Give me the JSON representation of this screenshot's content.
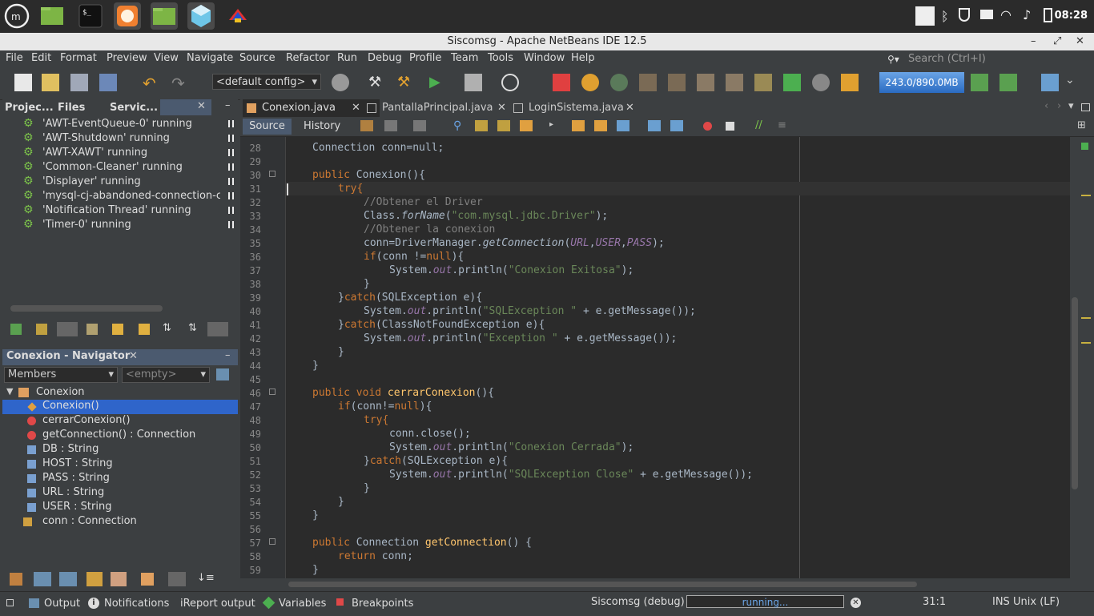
{
  "taskbar": {
    "apps": [
      "mint-menu-icon",
      "files-icon",
      "terminal-icon",
      "firefox-icon",
      "folder-icon",
      "netbeans-icon",
      "colorful-app-icon"
    ],
    "clock": "08:28"
  },
  "window": {
    "title": "Siscomsg - Apache NetBeans IDE 12.5"
  },
  "menubar": {
    "items": [
      "File",
      "Edit",
      "Format",
      "Preview",
      "View",
      "Navigate",
      "Source",
      "Refactor",
      "Run",
      "Debug",
      "Profile",
      "Team",
      "Tools",
      "Window",
      "Help"
    ],
    "search_placeholder": "Search (Ctrl+I)"
  },
  "toolbar": {
    "config": "<default config>",
    "memory": "243.0/890.0MB"
  },
  "left_tabs": [
    "Projec...",
    "Files",
    "Servic..."
  ],
  "threads": [
    "'AWT-EventQueue-0' running",
    "'AWT-Shutdown' running",
    "'AWT-XAWT' running",
    "'Common-Cleaner' running",
    "'Displayer' running",
    "'mysql-cj-abandoned-connection-cle",
    "'Notification Thread' running",
    "'Timer-0' running"
  ],
  "navigator": {
    "title": "Conexion - Navigator",
    "filter": "Members",
    "empty": "<empty>",
    "class_name": "Conexion",
    "members": [
      {
        "name": "Conexion()",
        "type": ""
      },
      {
        "name": "cerrarConexion()",
        "type": ""
      },
      {
        "name": "getConnection() : ",
        "type": "Connection"
      },
      {
        "name": "DB : ",
        "type": "String"
      },
      {
        "name": "HOST : ",
        "type": "String"
      },
      {
        "name": "PASS : ",
        "type": "String"
      },
      {
        "name": "URL : ",
        "type": "String"
      },
      {
        "name": "USER : ",
        "type": "String"
      },
      {
        "name": "conn : ",
        "type": "Connection"
      }
    ]
  },
  "editor_tabs": [
    "Conexion.java",
    "PantallaPrincipal.java",
    "LoginSistema.java"
  ],
  "source_tabs": {
    "source": "Source",
    "history": "History"
  },
  "line_numbers": [
    "28",
    "29",
    "30",
    "31",
    "32",
    "33",
    "34",
    "35",
    "36",
    "37",
    "38",
    "39",
    "40",
    "41",
    "42",
    "43",
    "44",
    "45",
    "46",
    "47",
    "48",
    "49",
    "50",
    "51",
    "52",
    "53",
    "54",
    "55",
    "56",
    "57",
    "58",
    "59"
  ],
  "code": {
    "l28": "Connection conn=null;",
    "l30a": "public ",
    "l30b": "Conexion(){",
    "l31": "try{",
    "l32": "//Obtener el Driver",
    "l33a": "Class.",
    "l33b": "forName",
    "l33c": "(",
    "l33d": "\"com.mysql.jdbc.Driver\"",
    "l33e": ");",
    "l34": "//Obtener la conexion",
    "l35a": "conn=DriverManager.",
    "l35b": "getConnection",
    "l35c": "(",
    "l35d": "URL",
    "l35e": ",",
    "l35f": "USER",
    "l35g": ",",
    "l35h": "PASS",
    "l35i": ");",
    "l36a": "if",
    "l36b": "(conn !=",
    "l36c": "null",
    "l36d": "){",
    "l37a": "System.",
    "l37b": "out",
    "l37c": ".println(",
    "l37d": "\"Conexion Exitosa\"",
    "l37e": ");",
    "l38": "}",
    "l39a": "}",
    "l39b": "catch",
    "l39c": "(SQLException e){",
    "l40a": "System.",
    "l40b": "out",
    "l40c": ".println(",
    "l40d": "\"SQLException \"",
    "l40e": " + e.getMessage());",
    "l41a": "}",
    "l41b": "catch",
    "l41c": "(ClassNotFoundException e){",
    "l42a": "System.",
    "l42b": "out",
    "l42c": ".println(",
    "l42d": "\"Exception \"",
    "l42e": " + e.getMessage());",
    "l43": "}",
    "l44": "}",
    "l46a": "public void ",
    "l46b": "cerrarConexion",
    "l46c": "(){",
    "l47a": "if",
    "l47b": "(conn!=",
    "l47c": "null",
    "l47d": "){",
    "l48": "try{",
    "l49": "conn.close();",
    "l50a": "System.",
    "l50b": "out",
    "l50c": ".println(",
    "l50d": "\"Conexion Cerrada\"",
    "l50e": ");",
    "l51a": "}",
    "l51b": "catch",
    "l51c": "(SQLException e){",
    "l52a": "System.",
    "l52b": "out",
    "l52c": ".println(",
    "l52d": "\"SQLException Close\"",
    "l52e": " + e.getMessage());",
    "l53": "}",
    "l54": "}",
    "l55": "}",
    "l57a": "public ",
    "l57b": "Connection ",
    "l57c": "getConnection",
    "l57d": "() {",
    "l58a": "return ",
    "l58b": "conn;",
    "l59": "}"
  },
  "status": {
    "output": "Output",
    "notifications": "Notifications",
    "ireport": "iReport output",
    "variables": "Variables",
    "breakpoints": "Breakpoints",
    "session": "Siscomsg (debug)",
    "progress": "running...",
    "position": "31:1",
    "mode": "INS",
    "eol": "Unix (LF)"
  },
  "colors": {
    "keyword": "#cc7832",
    "string": "#6a8759",
    "comment": "#808080",
    "field": "#9876aa",
    "method": "#ffc66d",
    "selection": "#2f65ca"
  }
}
